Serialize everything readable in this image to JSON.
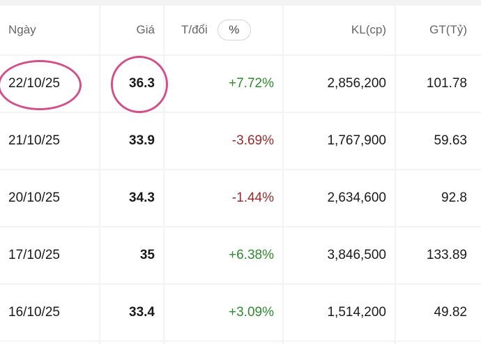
{
  "headers": {
    "date": "Ngày",
    "price": "Giá",
    "change": "T/đổi",
    "change_toggle": "%",
    "volume": "KL(cp)",
    "value": "GT(Tỷ)"
  },
  "rows": [
    {
      "date": "22/10/25",
      "price": "36.3",
      "change": "+7.72%",
      "direction": "up",
      "volume": "2,856,200",
      "value": "101.78"
    },
    {
      "date": "21/10/25",
      "price": "33.9",
      "change": "-3.69%",
      "direction": "down",
      "volume": "1,767,900",
      "value": "59.63"
    },
    {
      "date": "20/10/25",
      "price": "34.3",
      "change": "-1.44%",
      "direction": "down",
      "volume": "2,634,600",
      "value": "92.8"
    },
    {
      "date": "17/10/25",
      "price": "35",
      "change": "+6.38%",
      "direction": "up",
      "volume": "3,846,500",
      "value": "133.89"
    },
    {
      "date": "16/10/25",
      "price": "33.4",
      "change": "+3.09%",
      "direction": "up",
      "volume": "1,514,200",
      "value": "49.82"
    }
  ],
  "colors": {
    "up": "#2f8a2f",
    "down": "#9a2a2a",
    "highlight_circle": "#d24f8a"
  }
}
